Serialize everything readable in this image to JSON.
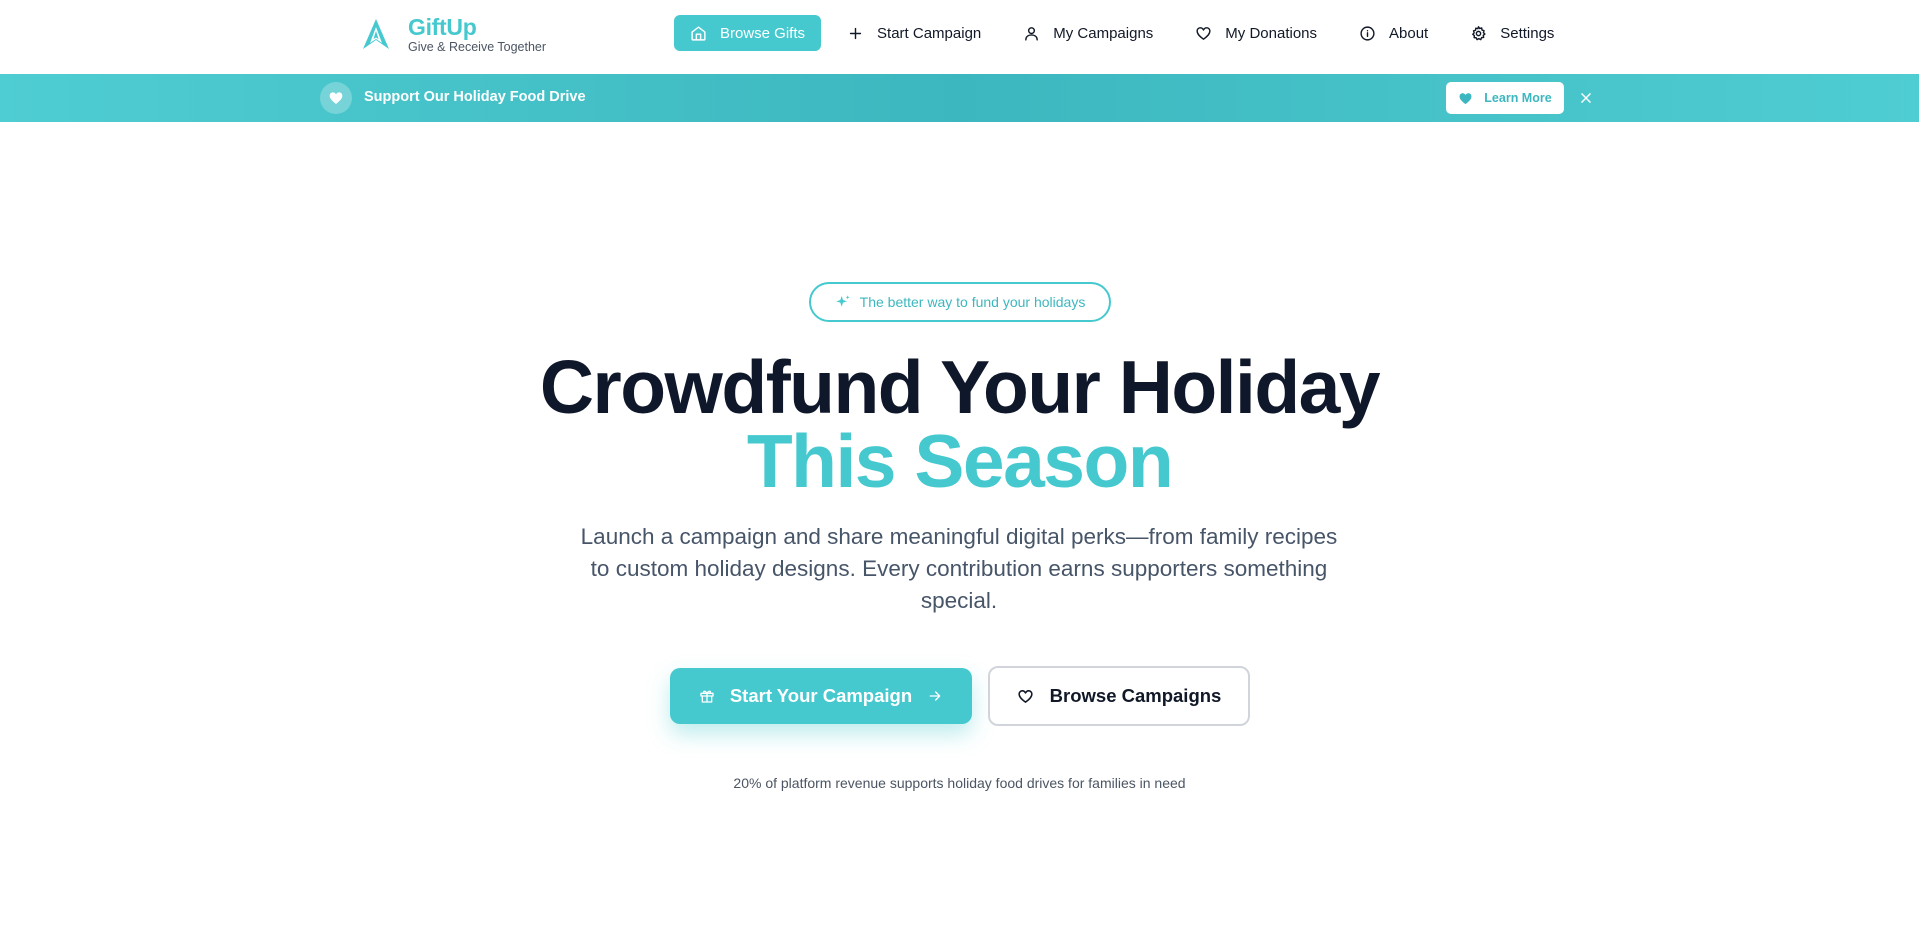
{
  "brand": {
    "name": "GiftUp",
    "tagline": "Give & Receive Together",
    "color": "#45c9cf"
  },
  "nav": {
    "items": [
      {
        "label": "Browse Gifts",
        "icon": "home-icon",
        "active": true
      },
      {
        "label": "Start Campaign",
        "icon": "plus-icon",
        "active": false
      },
      {
        "label": "My Campaigns",
        "icon": "user-icon",
        "active": false
      },
      {
        "label": "My Donations",
        "icon": "heart-icon",
        "active": false
      },
      {
        "label": "About",
        "icon": "info-icon",
        "active": false
      },
      {
        "label": "Settings",
        "icon": "gear-icon",
        "active": false
      }
    ]
  },
  "banner": {
    "icon": "heart-icon",
    "text": "Support Our Holiday Food Drive",
    "button_label": "Learn More",
    "button_icon": "heart-icon",
    "close_icon": "close-icon",
    "background": "#45c9cf"
  },
  "hero": {
    "pill_icon": "sparkles-icon",
    "pill_text": "The better way to fund your holidays",
    "headline_line1": "Crowdfund Your Holiday",
    "headline_line2": "This Season",
    "subtitle": "Launch a campaign and share meaningful digital perks—from family recipes to custom holiday designs. Every contribution earns supporters something special.",
    "primary_cta": {
      "label": "Start Your Campaign",
      "icon": "gift-icon",
      "trailing_icon": "arrow-right-icon"
    },
    "secondary_cta": {
      "label": "Browse Campaigns",
      "icon": "heart-icon"
    },
    "footnote": "20% of platform revenue supports holiday food drives for families in need"
  },
  "colors": {
    "accent": "#45c9cf",
    "heading": "#0f172a",
    "body_text": "#475569"
  }
}
